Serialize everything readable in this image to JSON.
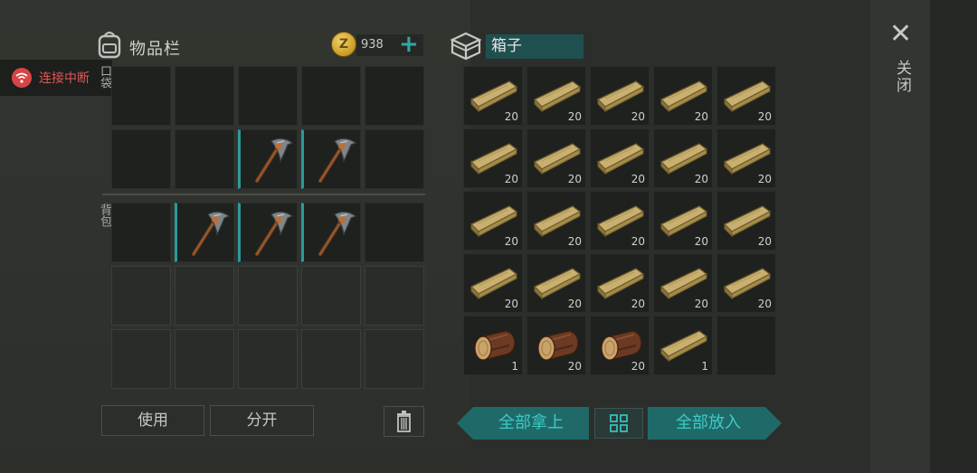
{
  "inventory": {
    "title": "物品栏",
    "coin_count": "938",
    "pocket_label": "口袋",
    "backpack_label": "背包",
    "pocket": [
      {
        "item": "",
        "count": ""
      },
      {
        "item": "",
        "count": ""
      },
      {
        "item": "",
        "count": ""
      },
      {
        "item": "",
        "count": ""
      },
      {
        "item": "",
        "count": ""
      },
      {
        "item": "",
        "count": ""
      },
      {
        "item": "",
        "count": ""
      },
      {
        "item": "pickaxe-icon",
        "count": ""
      },
      {
        "item": "pickaxe-icon",
        "count": ""
      },
      {
        "item": "",
        "count": ""
      }
    ],
    "backpack": [
      {
        "item": "",
        "count": ""
      },
      {
        "item": "pickaxe-icon",
        "count": ""
      },
      {
        "item": "pickaxe-icon",
        "count": ""
      },
      {
        "item": "pickaxe-icon",
        "count": ""
      },
      {
        "item": "",
        "count": ""
      },
      {
        "item": "",
        "count": ""
      },
      {
        "item": "",
        "count": ""
      },
      {
        "item": "",
        "count": ""
      },
      {
        "item": "",
        "count": ""
      },
      {
        "item": "",
        "count": ""
      },
      {
        "item": "",
        "count": ""
      },
      {
        "item": "",
        "count": ""
      },
      {
        "item": "",
        "count": ""
      },
      {
        "item": "",
        "count": ""
      },
      {
        "item": "",
        "count": ""
      }
    ],
    "use_label": "使用",
    "split_label": "分开"
  },
  "connection": {
    "status": "连接中断"
  },
  "chest": {
    "name": "箱子",
    "slots": [
      {
        "item": "plank-icon",
        "count": "20"
      },
      {
        "item": "plank-icon",
        "count": "20"
      },
      {
        "item": "plank-icon",
        "count": "20"
      },
      {
        "item": "plank-icon",
        "count": "20"
      },
      {
        "item": "plank-icon",
        "count": "20"
      },
      {
        "item": "plank-icon",
        "count": "20"
      },
      {
        "item": "plank-icon",
        "count": "20"
      },
      {
        "item": "plank-icon",
        "count": "20"
      },
      {
        "item": "plank-icon",
        "count": "20"
      },
      {
        "item": "plank-icon",
        "count": "20"
      },
      {
        "item": "plank-icon",
        "count": "20"
      },
      {
        "item": "plank-icon",
        "count": "20"
      },
      {
        "item": "plank-icon",
        "count": "20"
      },
      {
        "item": "plank-icon",
        "count": "20"
      },
      {
        "item": "plank-icon",
        "count": "20"
      },
      {
        "item": "plank-icon",
        "count": "20"
      },
      {
        "item": "plank-icon",
        "count": "20"
      },
      {
        "item": "plank-icon",
        "count": "20"
      },
      {
        "item": "plank-icon",
        "count": "20"
      },
      {
        "item": "plank-icon",
        "count": "20"
      },
      {
        "item": "log-icon",
        "count": "1"
      },
      {
        "item": "log-icon",
        "count": "20"
      },
      {
        "item": "log-icon",
        "count": "20"
      },
      {
        "item": "plank-icon",
        "count": "1"
      },
      {
        "item": "",
        "count": ""
      }
    ],
    "take_all_label": "全部拿上",
    "put_all_label": "全部放入"
  },
  "close_label": "关闭",
  "colors": {
    "accent": "#2fa7a6",
    "alert": "#e25656",
    "chest_name_bg": "#1f4f4f"
  }
}
